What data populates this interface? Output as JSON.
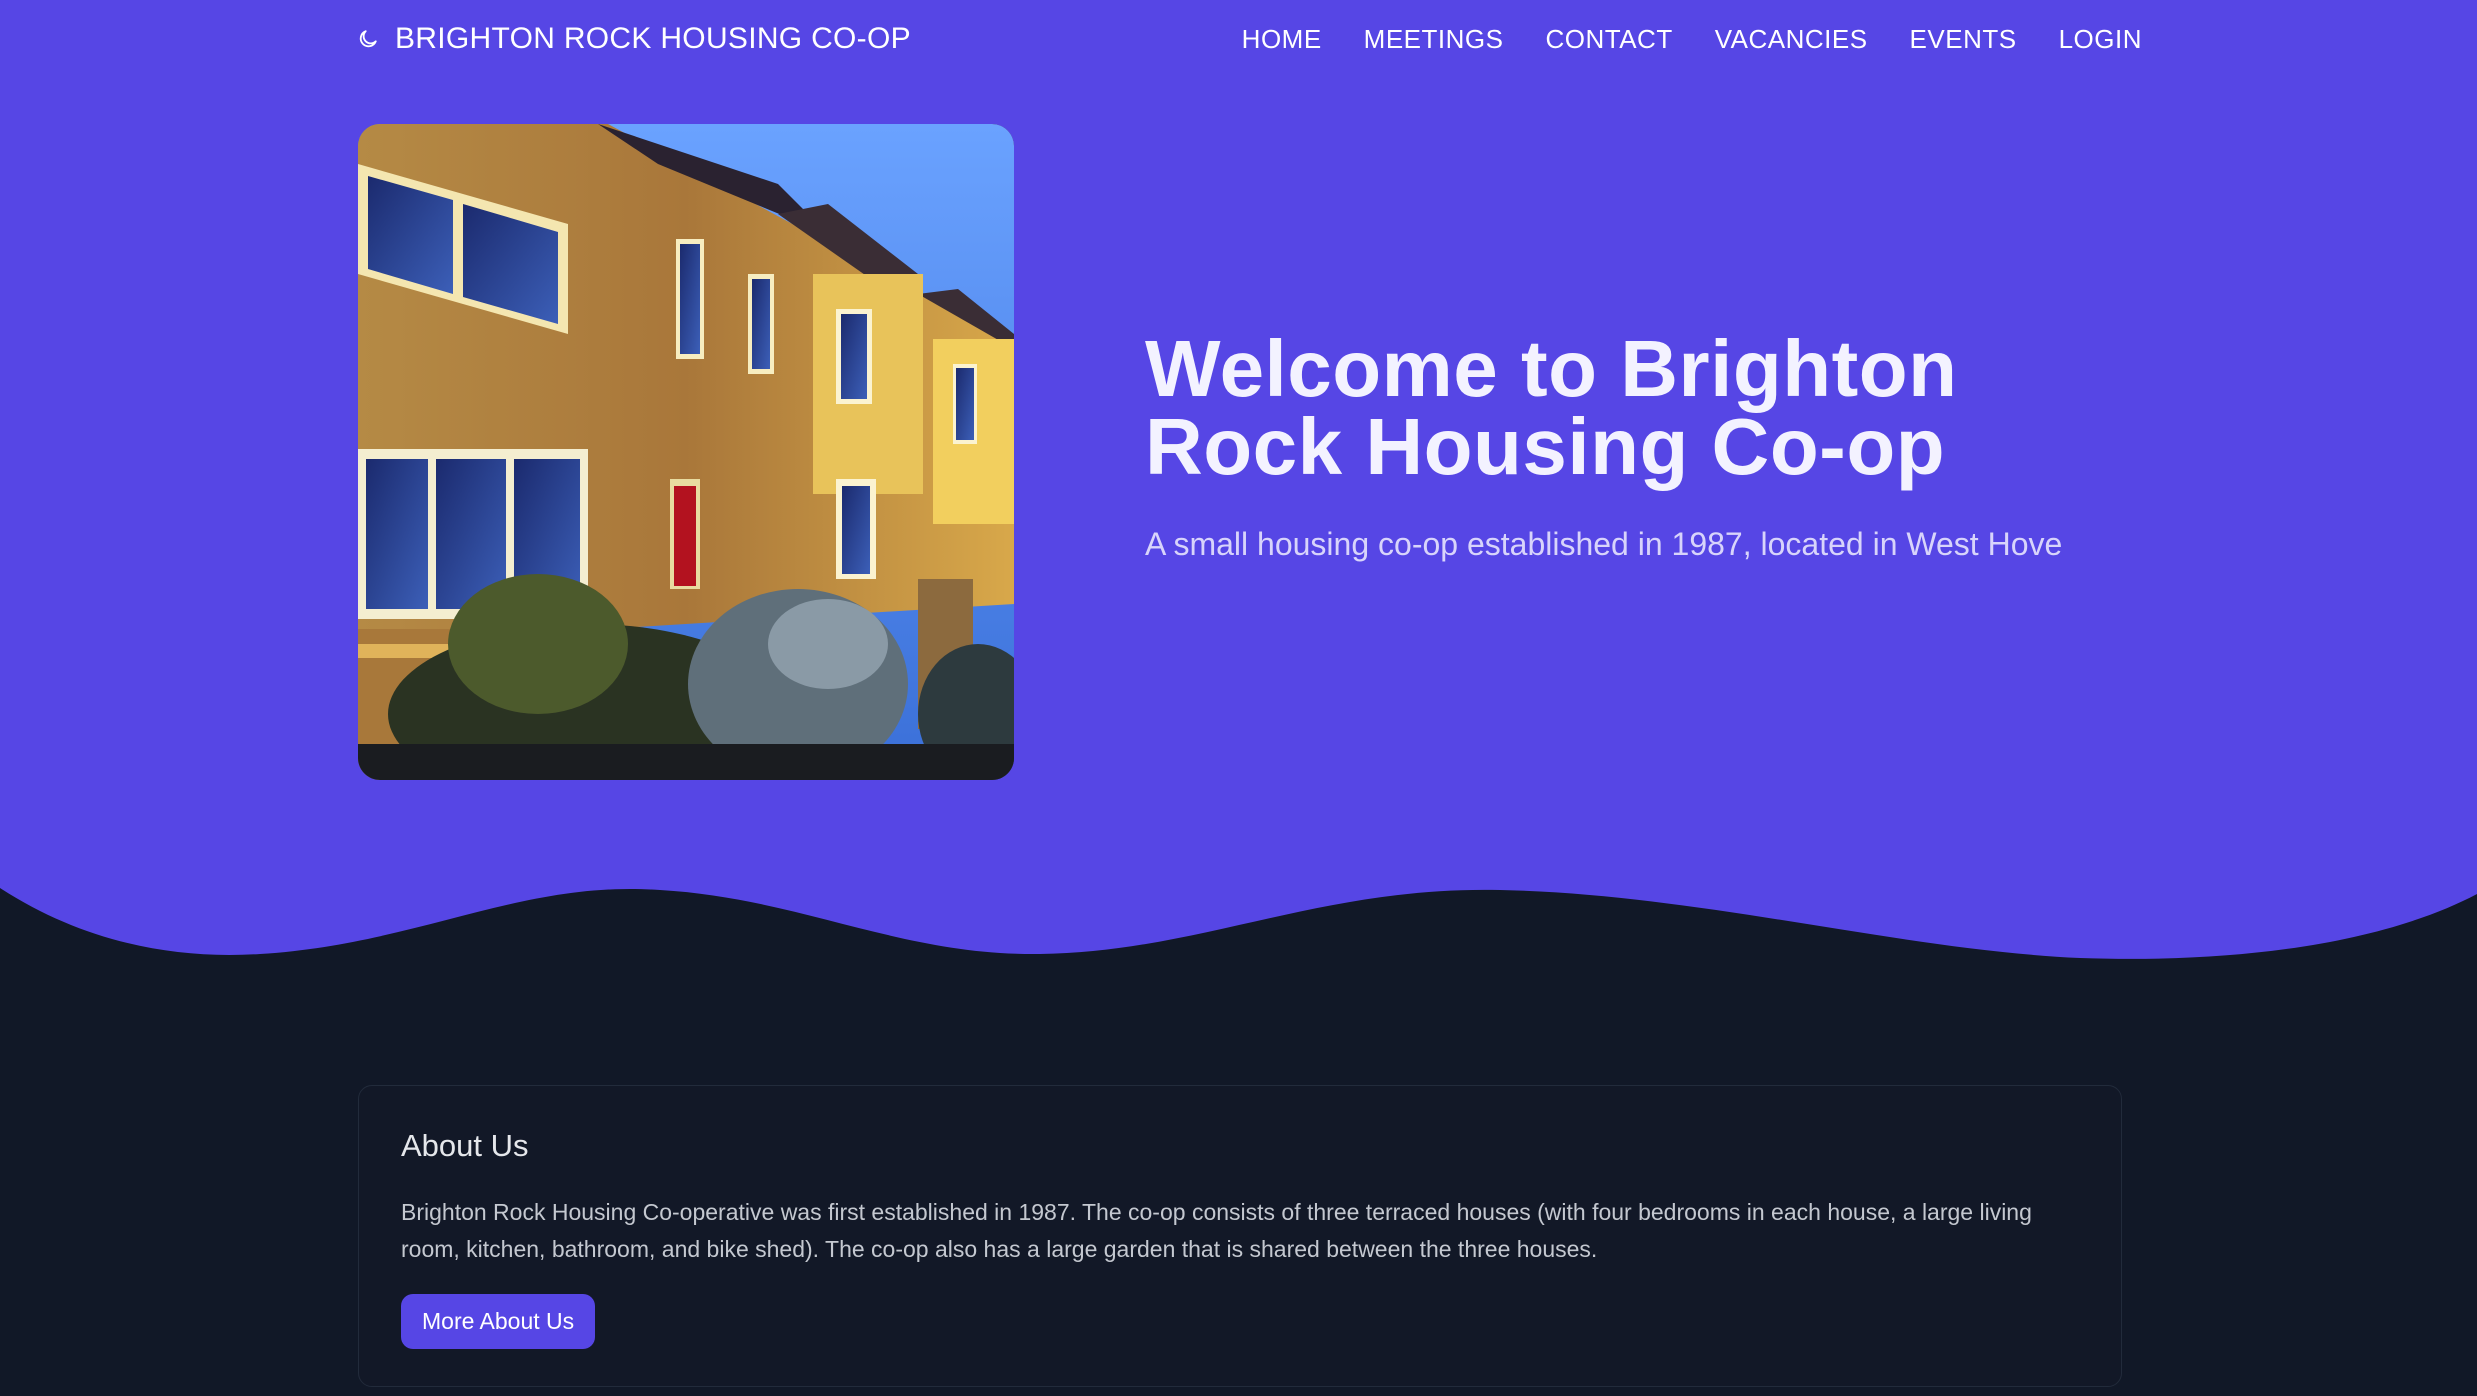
{
  "brand": {
    "name": "BRIGHTON ROCK HOUSING CO-OP",
    "icon": "moon-icon"
  },
  "nav": {
    "items": [
      {
        "label": "HOME"
      },
      {
        "label": "MEETINGS"
      },
      {
        "label": "CONTACT"
      },
      {
        "label": "VACANCIES"
      },
      {
        "label": "EVENTS"
      },
      {
        "label": "LOGIN"
      }
    ]
  },
  "hero": {
    "title": "Welcome to Brighton Rock Housing Co-op",
    "subtitle": "A small housing co-op established in 1987, located in West Hove",
    "image": "terraced-houses-photo"
  },
  "about": {
    "title": "About Us",
    "body": "Brighton Rock Housing Co-operative was first established in 1987. The co-op consists of three terraced houses (with four bedrooms in each house, a large living room, kitchen, bathroom, and bike shed). The co-op also has a large garden that is shared between the three houses.",
    "button_label": "More About Us"
  },
  "colors": {
    "hero_background": "#5646e5",
    "page_background": "#111827",
    "accent": "#5646e5",
    "card_border": "#222b3b"
  }
}
